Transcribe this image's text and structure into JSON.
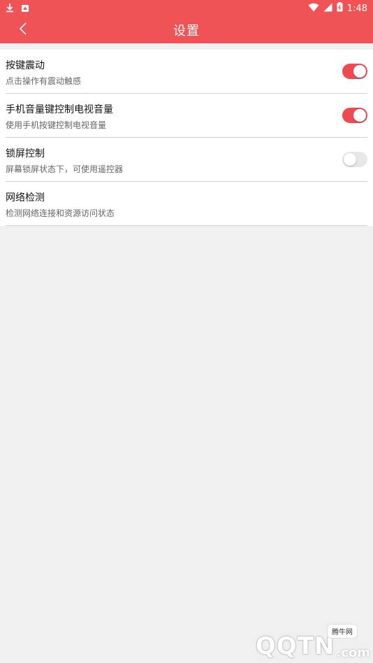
{
  "status_bar": {
    "time": "1:48",
    "left_icons": [
      "download-icon",
      "notification-icon"
    ],
    "right_icons": [
      "wifi-icon",
      "signal-icon",
      "battery-icon"
    ]
  },
  "header": {
    "title": "设置",
    "back_icon": "chevron-left-icon",
    "bg_color": "#f05355"
  },
  "settings": {
    "items": [
      {
        "label": "按键震动",
        "desc": "点击操作有震动触感",
        "toggle": "on"
      },
      {
        "label": "手机音量键控制电视音量",
        "desc": "使用手机按键控制电视音量",
        "toggle": "on"
      },
      {
        "label": "锁屏控制",
        "desc": "屏幕锁屏状态下，可使用遥控器",
        "toggle": "off"
      },
      {
        "label": "网络检测",
        "desc": "检测网络连接和资源访问状态",
        "toggle": null
      }
    ]
  },
  "watermark": {
    "logo": "QQTN",
    "suffix": ".com",
    "badge": "腾牛网"
  },
  "colors": {
    "accent": "#f05355",
    "toggle_on": "#ef4a50",
    "toggle_off": "#e7e7e7",
    "background": "#f0f0f0"
  }
}
